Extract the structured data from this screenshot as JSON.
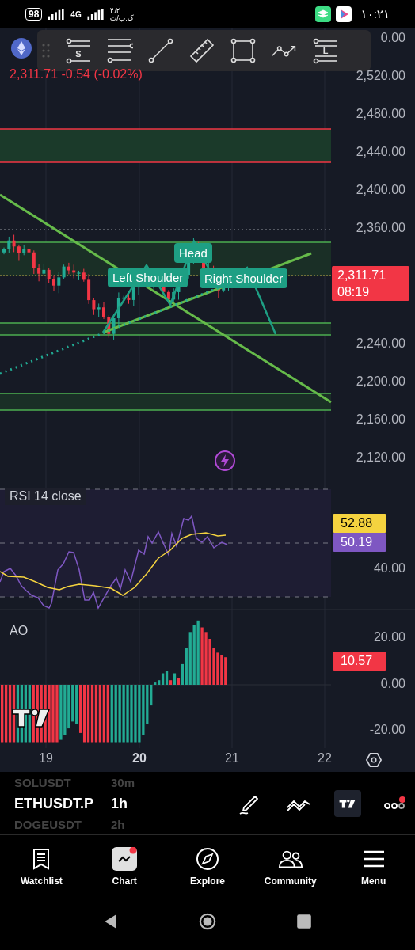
{
  "status_bar": {
    "battery": "98",
    "network": "4G",
    "data_speed": [
      "۴٫۲",
      "ک.ب/ث"
    ],
    "time": "۱۰:۲۱"
  },
  "drawing_toolbar": [
    {
      "kind": "lines-s",
      "letter": "S"
    },
    {
      "kind": "channel"
    },
    {
      "kind": "trend"
    },
    {
      "kind": "ruler"
    },
    {
      "kind": "rectangle"
    },
    {
      "kind": "path"
    },
    {
      "kind": "lines-l",
      "letter": "L"
    }
  ],
  "chart": {
    "quote": "2,311.71 -0.54 (-0.02%)",
    "price_axis_upper": [
      "0.00",
      "2,520.00",
      "2,480.00",
      "2,440.00",
      "2,400.00",
      "2,360.00"
    ],
    "price_axis_lower": [
      "2,240.00",
      "2,200.00",
      "2,160.00",
      "2,120.00"
    ],
    "last_price": {
      "value": "2,311.71",
      "countdown": "08:19"
    },
    "pattern_labels": [
      "Left Shoulder",
      "Head",
      "Right Shoulder"
    ]
  },
  "rsi": {
    "title": "RSI 14 close",
    "labels": [
      {
        "text": "52.88",
        "color": "#f5d33f"
      },
      {
        "text": "50.19",
        "color": "#7e57c2"
      }
    ],
    "axis": [
      "40.00"
    ]
  },
  "ao": {
    "title": "AO",
    "axis": [
      "20.00",
      "0.00",
      "-20.00"
    ],
    "label": "10.57"
  },
  "time_axis": [
    {
      "text": "19",
      "bold": false
    },
    {
      "text": "20",
      "bold": true
    },
    {
      "text": "21",
      "bold": false
    },
    {
      "text": "22",
      "bold": false
    }
  ],
  "symbols": [
    {
      "symbol": "SOLUSDT",
      "interval": "30m",
      "selected": false
    },
    {
      "symbol": "ETHUSDT.P",
      "interval": "1h",
      "selected": true
    },
    {
      "symbol": "DOGEUSDT",
      "interval": "2h",
      "selected": false
    }
  ],
  "nav": [
    {
      "kind": "watchlist",
      "label": "Watchlist",
      "selected": false
    },
    {
      "kind": "chart",
      "label": "Chart",
      "selected": true
    },
    {
      "kind": "explore",
      "label": "Explore",
      "selected": false
    },
    {
      "kind": "community",
      "label": "Community",
      "selected": false
    },
    {
      "kind": "menu",
      "label": "Menu",
      "selected": false
    }
  ]
}
